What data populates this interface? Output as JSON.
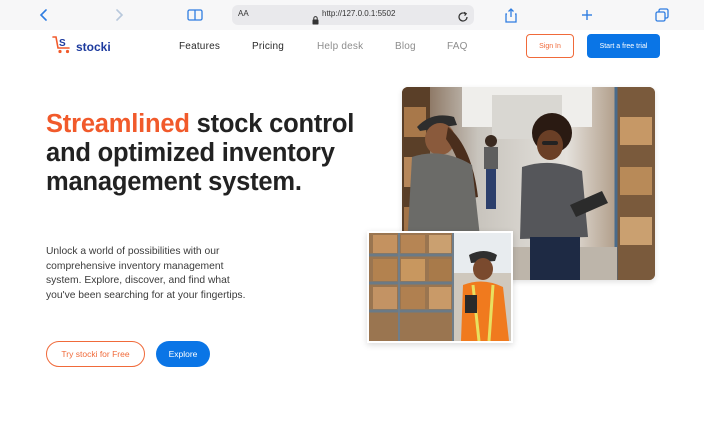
{
  "browser": {
    "url_aa": "AA",
    "url": "http://127.0.0.1:5502",
    "icons": [
      "back-icon",
      "forward-icon",
      "book-icon",
      "lock-icon",
      "reload-icon",
      "share-icon",
      "plus-icon",
      "tabs-icon"
    ]
  },
  "nav": {
    "logo_text": "stocki",
    "links": [
      "Features",
      "Pricing",
      "Help desk",
      "Blog",
      "FAQ"
    ],
    "signin_label": "Sign In",
    "trial_label": "Start a free trial"
  },
  "hero": {
    "title_accent": "Streamlined",
    "title_rest": " stock control and optimized inventory management system.",
    "description": "Unlock a world of possibilities with our comprehensive inventory management system. Explore, discover, and find what you've been searching for at your fingertips.",
    "try_label": "Try stocki for Free",
    "explore_label": "Explore"
  },
  "colors": {
    "accent": "#f15a2b",
    "primary": "#0a75e6",
    "logo": "#1c3a9e"
  }
}
